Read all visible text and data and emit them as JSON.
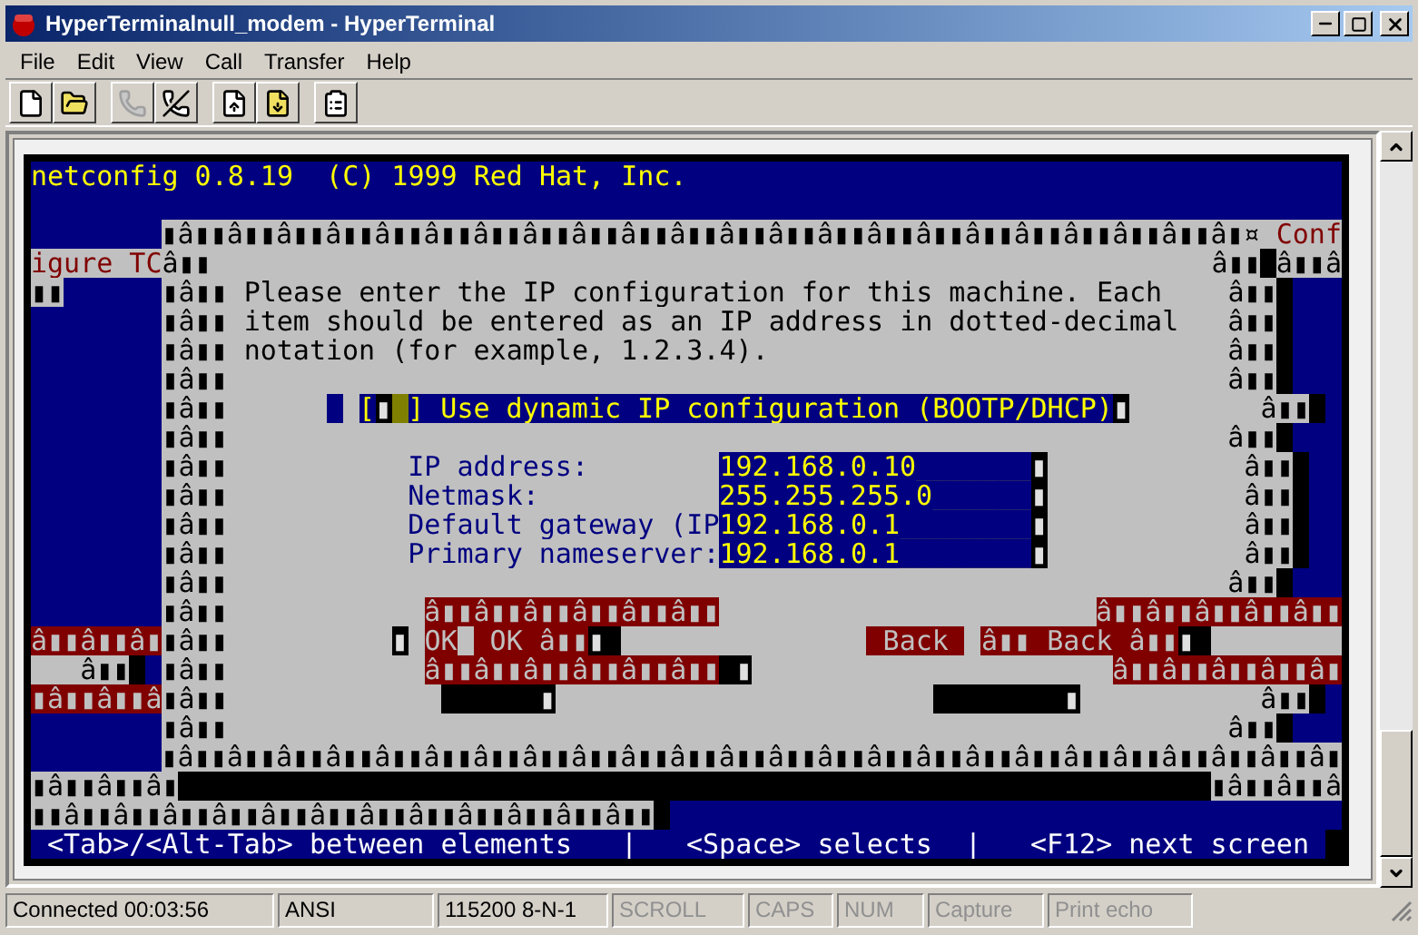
{
  "window": {
    "title": "HyperTerminalnull_modem - HyperTerminal"
  },
  "menu": [
    "File",
    "Edit",
    "View",
    "Call",
    "Transfer",
    "Help"
  ],
  "toolbar": [
    {
      "disabled": false
    },
    {
      "disabled": false
    },
    {
      "disabled": true
    },
    {
      "disabled": false
    },
    {
      "disabled": false
    },
    {
      "disabled": false
    },
    {
      "disabled": false
    }
  ],
  "terminal": {
    "rows": [
      {
        "segments": [
          {
            "kind": "screen",
            "text": "netconfig 0.8.19  (C) 1999 Red Hat, Inc."
          }
        ]
      },
      {
        "segments": [
          {
            "kind": "dialog",
            "text": "▮â▮▮â▮▮â▮▮â▮▮â▮▮â▮▮â▮▮â▮▮â▮▮â▮▮â▮▮â▮▮â▮▮â▮▮â▮▮â▮▮â▮▮â▮▮â▮▮â▮▮â▮▮â▮¤ "
          },
          {
            "kind": "title",
            "text": "Conf"
          }
        ]
      },
      {
        "segments": [
          {
            "kind": "title",
            "text": "igure TC"
          },
          {
            "kind": "dialog",
            "text": "â▮▮                                                             â▮▮"
          },
          {
            "kind": "dialog",
            "text": "â▮▮â"
          }
        ]
      },
      {
        "segments": [
          {
            "kind": "dialog",
            "text": "▮▮"
          },
          {
            "kind": "dialog",
            "text": "▮â▮▮ Please enter the IP configuration for this machine. Each    â▮▮"
          }
        ]
      },
      {
        "segments": [
          {
            "kind": "dialog",
            "text": "▮â▮▮ item should be entered as an IP address in dotted-decimal   â▮▮"
          }
        ]
      },
      {
        "segments": [
          {
            "kind": "dialog",
            "text": "▮â▮▮ notation (for example, 1.2.3.4).                            â▮▮"
          }
        ]
      },
      {
        "segments": [
          {
            "kind": "dialog",
            "text": "▮â▮▮                                                             â▮▮"
          }
        ]
      },
      {
        "segments": [
          {
            "kind": "dialog",
            "text": "▮â▮▮      "
          },
          {
            "kind": "field",
            "text": "["
          },
          {
            "kind": "shadow",
            "text": "▮"
          },
          {
            "kind": "field",
            "text": "] Use dynamic IP configuration (BOOTP/DHCP)"
          },
          {
            "kind": "shadow",
            "text": "▮"
          },
          {
            "kind": "dialog",
            "text": "        â▮▮"
          }
        ]
      },
      {
        "segments": [
          {
            "kind": "dialog",
            "text": "▮â▮▮                                                             â▮▮"
          }
        ]
      },
      {
        "segments": [
          {
            "kind": "dialog",
            "text": "▮â▮▮           "
          },
          {
            "kind": "label",
            "text": "IP address:"
          },
          {
            "kind": "field",
            "text": "192.168.0.10_______"
          },
          {
            "kind": "shadow",
            "text": "▮"
          },
          {
            "kind": "dialog",
            "text": "            â▮▮"
          }
        ]
      },
      {
        "segments": [
          {
            "kind": "dialog",
            "text": "▮â▮▮           "
          },
          {
            "kind": "label",
            "text": "Netmask:"
          },
          {
            "kind": "field",
            "text": "255.255.255.0______"
          },
          {
            "kind": "shadow",
            "text": "▮"
          },
          {
            "kind": "dialog",
            "text": "            â▮▮"
          }
        ]
      },
      {
        "segments": [
          {
            "kind": "dialog",
            "text": "▮â▮▮           "
          },
          {
            "kind": "label",
            "text": "Default gateway (IP"
          },
          {
            "kind": "field",
            "text": "192.168.0.1________"
          },
          {
            "kind": "shadow",
            "text": "▮"
          },
          {
            "kind": "dialog",
            "text": "            â▮▮"
          }
        ]
      },
      {
        "segments": [
          {
            "kind": "dialog",
            "text": "▮â▮▮           "
          },
          {
            "kind": "label",
            "text": "Primary nameserver:"
          },
          {
            "kind": "field",
            "text": "192.168.0.1________"
          },
          {
            "kind": "shadow",
            "text": "▮"
          },
          {
            "kind": "dialog",
            "text": "            â▮▮"
          }
        ]
      },
      {
        "segments": [
          {
            "kind": "dialog",
            "text": "▮â▮▮                                                             â▮▮"
          }
        ]
      },
      {
        "segments": [
          {
            "kind": "dialog",
            "text": "▮â▮▮            "
          },
          {
            "kind": "button",
            "text": "â▮▮â▮▮â▮▮â▮▮â▮▮â▮▮"
          },
          {
            "kind": "button",
            "text": "â▮▮â▮▮â▮▮â▮▮â▮▮"
          }
        ]
      },
      {
        "segments": [
          {
            "kind": "button",
            "text": "â▮▮â▮▮â▮"
          },
          {
            "kind": "dialog",
            "text": "▮â▮▮          "
          },
          {
            "kind": "shadow",
            "text": "▮"
          },
          {
            "kind": "button",
            "text": "OK"
          },
          {
            "kind": "button",
            "text": " OK â▮▮"
          },
          {
            "kind": "shadow",
            "text": "▮ "
          },
          {
            "kind": "button",
            "text": " Back "
          },
          {
            "kind": "button",
            "text": "â▮▮ Back â▮▮"
          },
          {
            "kind": "shadow",
            "text": "▮ "
          }
        ]
      },
      {
        "segments": [
          {
            "kind": "dialog",
            "text": "   â▮▮"
          },
          {
            "kind": "dialog",
            "text": "▮â▮▮            "
          },
          {
            "kind": "button",
            "text": "â▮▮â▮▮â▮▮â▮▮â▮▮â▮▮"
          },
          {
            "kind": "shadow",
            "text": " ▮"
          },
          {
            "kind": "button",
            "text": "â▮▮â▮▮â▮▮â▮▮â▮"
          }
        ]
      },
      {
        "segments": [
          {
            "kind": "button",
            "text": "▮â▮▮â▮▮â"
          },
          {
            "kind": "dialog",
            "text": "▮â▮▮             "
          },
          {
            "kind": "shadow",
            "text": "      ▮"
          },
          {
            "kind": "shadow",
            "text": "        ▮"
          },
          {
            "kind": "dialog",
            "text": "           â▮▮"
          }
        ]
      },
      {
        "segments": [
          {
            "kind": "dialog",
            "text": "▮â▮▮                                                             â▮▮"
          }
        ]
      },
      {
        "segments": [
          {
            "kind": "dialog",
            "text": "▮â▮▮â▮▮â▮▮â▮▮â▮▮â▮▮â▮▮â▮▮â▮▮â▮▮â▮▮â▮▮â▮▮â▮▮â▮▮â▮▮â▮▮â▮▮â▮▮â▮▮â▮▮â▮▮â▮▮â▮"
          }
        ]
      },
      {
        "segments": [
          {
            "kind": "dialog",
            "text": "▮â▮▮â▮▮â▮"
          },
          {
            "kind": "dialog",
            "text": "▮â▮▮â▮▮â"
          }
        ]
      },
      {
        "segments": [
          {
            "kind": "dialog",
            "text": "▮▮â▮▮â▮▮â▮▮â▮▮â▮▮â▮▮â▮▮â▮▮â▮▮â▮▮â▮▮â▮▮"
          }
        ]
      },
      {
        "segments": [
          {
            "kind": "hint",
            "text": "<Tab>/<Alt-Tab> between elements"
          },
          {
            "kind": "hint",
            "text": "|"
          },
          {
            "kind": "hint",
            "text": "<Space> selects"
          },
          {
            "kind": "hint",
            "text": "|"
          },
          {
            "kind": "hint",
            "text": "<F12> next screen"
          }
        ]
      }
    ]
  },
  "status_bar": [
    {
      "text": "Connected 00:03:56",
      "disabled": false
    },
    {
      "text": "ANSI",
      "disabled": false
    },
    {
      "text": "115200 8-N-1",
      "disabled": false
    },
    {
      "text": "SCROLL",
      "disabled": true
    },
    {
      "text": "CAPS",
      "disabled": true
    },
    {
      "text": "NUM",
      "disabled": true
    },
    {
      "text": "Capture",
      "disabled": true
    },
    {
      "text": "Print echo",
      "disabled": true
    }
  ]
}
